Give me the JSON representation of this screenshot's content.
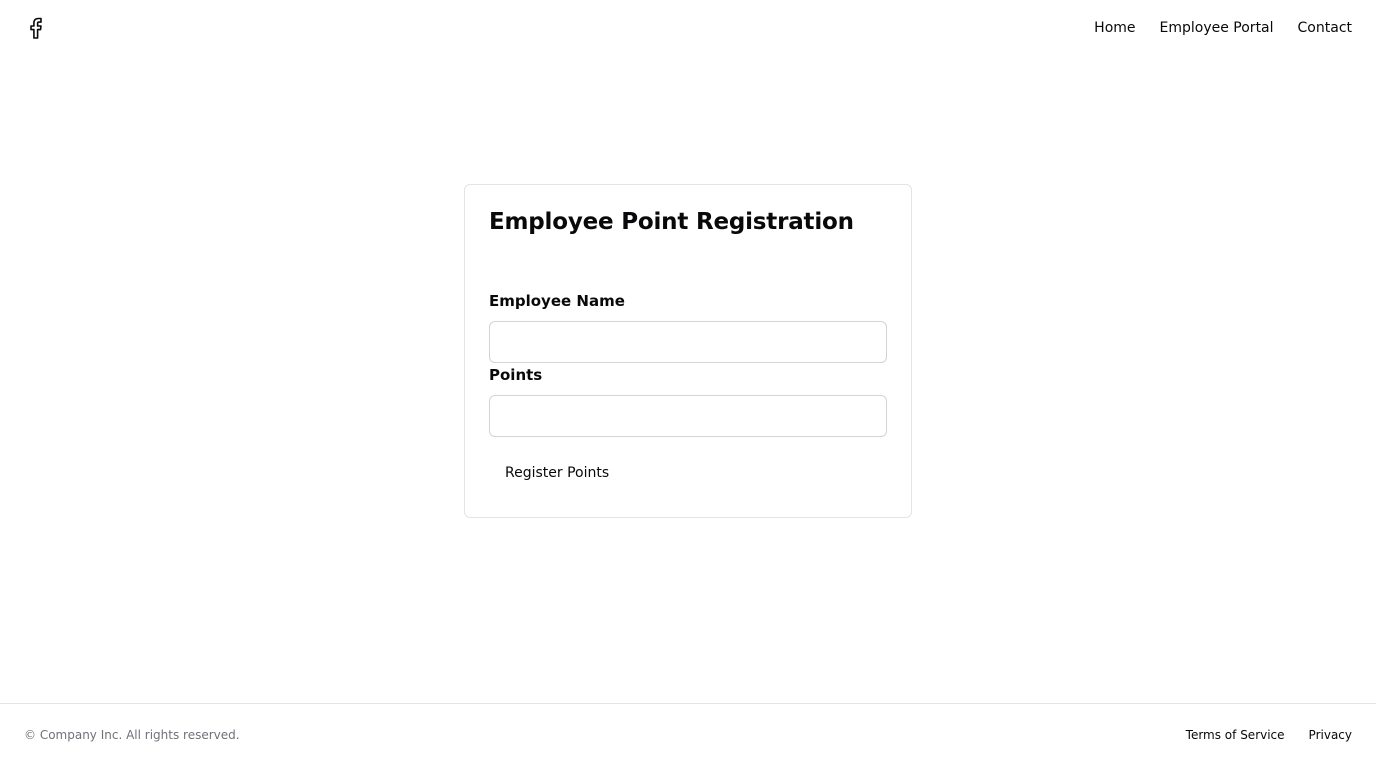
{
  "header": {
    "logo_icon": "facebook-icon",
    "nav": {
      "home": "Home",
      "employee_portal": "Employee Portal",
      "contact": "Contact"
    }
  },
  "form": {
    "title": "Employee Point Registration",
    "employee_name_label": "Employee Name",
    "employee_name_value": "",
    "points_label": "Points",
    "points_value": "",
    "submit_label": "Register Points"
  },
  "footer": {
    "copyright": "© Company Inc. All rights reserved.",
    "links": {
      "terms": "Terms of Service",
      "privacy": "Privacy"
    }
  },
  "colors": {
    "text": "#09090b",
    "muted": "#71717a",
    "border": "#e4e4e7"
  }
}
